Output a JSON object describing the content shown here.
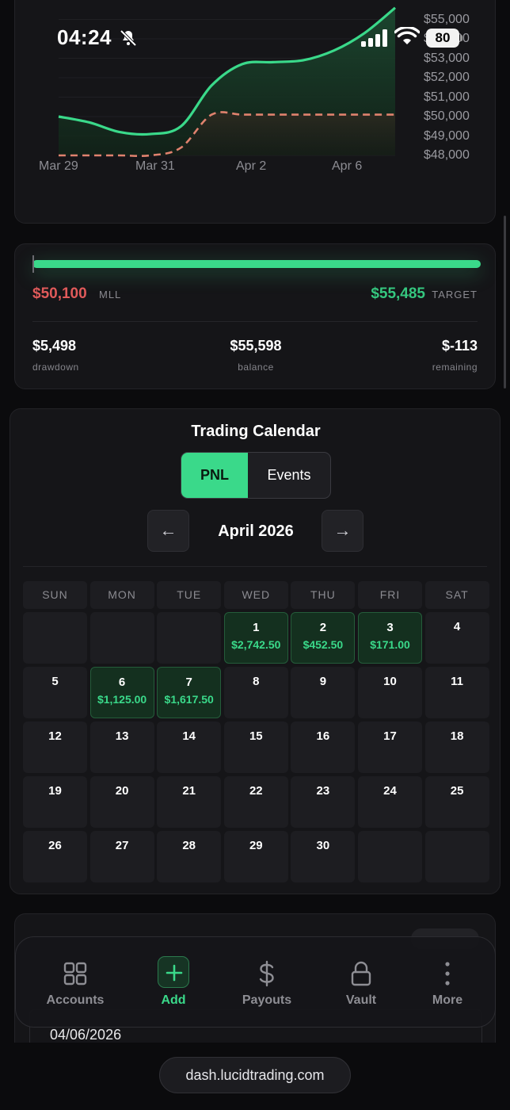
{
  "status_bar": {
    "time": "04:24",
    "battery": "80"
  },
  "chart_card": {
    "chart_data": {
      "type": "area",
      "x_ticks": [
        "Mar 29",
        "Mar 31",
        "Apr 2",
        "Apr 6"
      ],
      "y_ticks": [
        "$55,000",
        "$54,000",
        "$53,000",
        "$52,000",
        "$51,000",
        "$50,000",
        "$49,000",
        "$48,000"
      ],
      "ylim": [
        48000,
        56000
      ],
      "series": [
        {
          "style": "solid-green",
          "points": [
            [
              0,
              50000
            ],
            [
              1,
              49700
            ],
            [
              2,
              49200
            ],
            [
              3,
              49100
            ],
            [
              4,
              49500
            ],
            [
              5,
              51600
            ],
            [
              6,
              52700
            ],
            [
              7,
              52800
            ],
            [
              8,
              52900
            ],
            [
              9,
              53400
            ],
            [
              10,
              54300
            ],
            [
              11,
              55600
            ]
          ]
        },
        {
          "style": "dashed-salmon",
          "points": [
            [
              0,
              48000
            ],
            [
              1,
              48000
            ],
            [
              2,
              48000
            ],
            [
              3,
              48000
            ],
            [
              4,
              48400
            ],
            [
              5,
              50100
            ],
            [
              6,
              50100
            ],
            [
              7,
              50100
            ],
            [
              8,
              50100
            ],
            [
              9,
              50100
            ],
            [
              10,
              50100
            ],
            [
              11,
              50100
            ]
          ]
        }
      ],
      "grid": true,
      "colors": {
        "line": "#3ad98a",
        "floor": "#e0826e",
        "fill": "#12301f"
      }
    }
  },
  "progress": {
    "fill_fraction": 1.0,
    "mll_value": "$50,100",
    "mll_label": "MLL",
    "target_value": "$55,485",
    "target_label": "TARGET",
    "stats": [
      {
        "value": "$5,498",
        "label": "drawdown"
      },
      {
        "value": "$55,598",
        "label": "balance"
      },
      {
        "value": "$-113",
        "label": "remaining"
      }
    ]
  },
  "calendar": {
    "title": "Trading Calendar",
    "toggle": {
      "pnl": "PNL",
      "events": "Events"
    },
    "prev_icon": "←",
    "next_icon": "→",
    "month": "April 2026",
    "weekdays": [
      "SUN",
      "MON",
      "TUE",
      "WED",
      "THU",
      "FRI",
      "SAT"
    ],
    "first_weekday_index": 3,
    "days_in_month": 30,
    "pnl": {
      "1": "$2,742.50",
      "2": "$452.50",
      "3": "$171.00",
      "6": "$1,125.00",
      "7": "$1,617.50"
    }
  },
  "lower_card": {
    "date": "04/06/2026"
  },
  "tabbar": {
    "tabs": [
      {
        "label": "Accounts",
        "icon": "grid-icon"
      },
      {
        "label": "Add",
        "icon": "plus-icon",
        "active": true
      },
      {
        "label": "Payouts",
        "icon": "dollar-icon"
      },
      {
        "label": "Vault",
        "icon": "lock-icon"
      },
      {
        "label": "More",
        "icon": "more-dots-icon"
      }
    ]
  },
  "browser": {
    "url": "dash.lucidtrading.com"
  },
  "colors": {
    "accent": "#3ad98a",
    "loss": "#e05a5a",
    "background": "#0b0b0d",
    "card": "#151518"
  }
}
